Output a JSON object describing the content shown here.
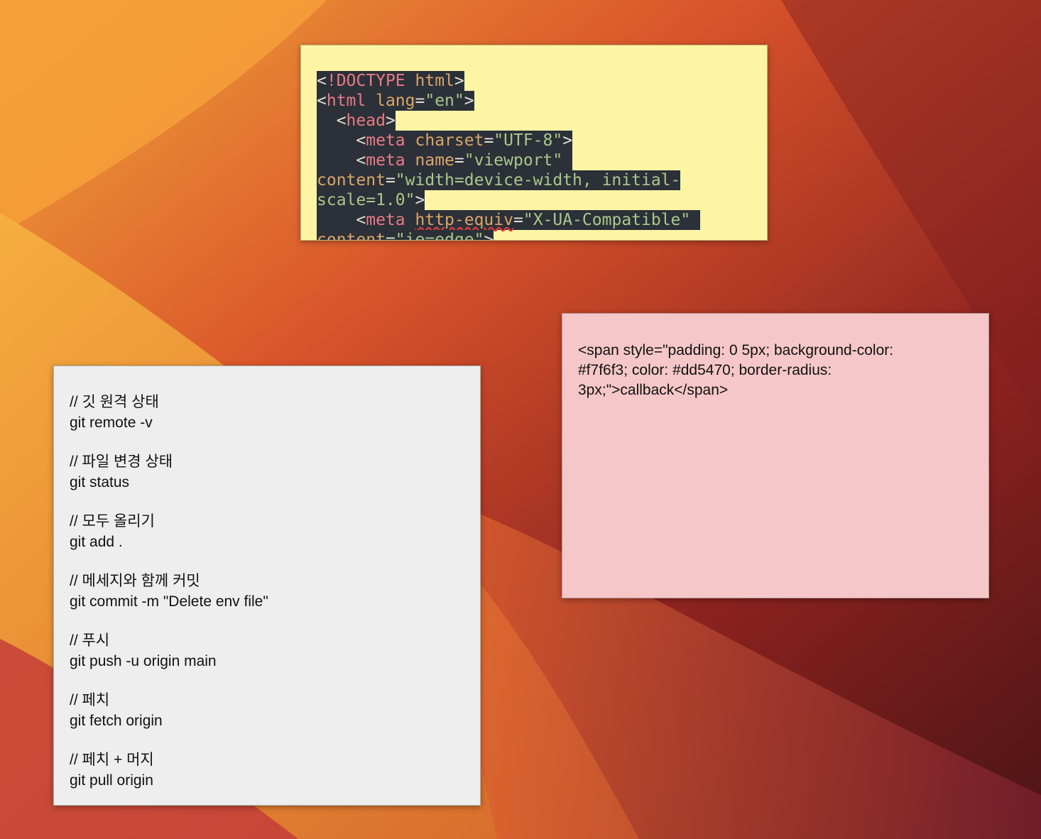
{
  "notes": {
    "yellow": {
      "color": "#fdf5a4",
      "code_lines": [
        [
          {
            "t": "<",
            "c": "punct"
          },
          {
            "t": "!DOCTYPE",
            "c": "bang"
          },
          {
            "t": " ",
            "c": "punct"
          },
          {
            "t": "html",
            "c": "attr"
          },
          {
            "t": ">",
            "c": "punct"
          }
        ],
        [
          {
            "t": "<",
            "c": "punct"
          },
          {
            "t": "html",
            "c": "tag"
          },
          {
            "t": " ",
            "c": "punct"
          },
          {
            "t": "lang",
            "c": "attr"
          },
          {
            "t": "=",
            "c": "punct"
          },
          {
            "t": "\"en\"",
            "c": "str"
          },
          {
            "t": ">",
            "c": "punct"
          }
        ],
        [
          {
            "t": "  <",
            "c": "punct"
          },
          {
            "t": "head",
            "c": "tag"
          },
          {
            "t": ">",
            "c": "punct"
          }
        ],
        [
          {
            "t": "    <",
            "c": "punct"
          },
          {
            "t": "meta",
            "c": "tag"
          },
          {
            "t": " ",
            "c": "punct"
          },
          {
            "t": "charset",
            "c": "attr"
          },
          {
            "t": "=",
            "c": "punct"
          },
          {
            "t": "\"UTF-8\"",
            "c": "str"
          },
          {
            "t": ">",
            "c": "punct"
          }
        ],
        [
          {
            "t": "    <",
            "c": "punct"
          },
          {
            "t": "meta",
            "c": "tag"
          },
          {
            "t": " ",
            "c": "punct"
          },
          {
            "t": "name",
            "c": "attr"
          },
          {
            "t": "=",
            "c": "punct"
          },
          {
            "t": "\"viewport\"",
            "c": "str"
          },
          {
            "t": " ",
            "c": "punct"
          }
        ],
        [
          {
            "t": "content",
            "c": "attr"
          },
          {
            "t": "=",
            "c": "punct"
          },
          {
            "t": "\"width=device-width, initial-",
            "c": "str"
          }
        ],
        [
          {
            "t": "scale=1.0\"",
            "c": "str"
          },
          {
            "t": ">",
            "c": "punct"
          }
        ],
        [
          {
            "t": "    <",
            "c": "punct"
          },
          {
            "t": "meta",
            "c": "tag"
          },
          {
            "t": " ",
            "c": "punct"
          },
          {
            "t": "http-equiv",
            "c": "attr err"
          },
          {
            "t": "=",
            "c": "punct"
          },
          {
            "t": "\"X-UA-Compatible\"",
            "c": "str"
          },
          {
            "t": " ",
            "c": "punct"
          }
        ],
        [
          {
            "t": "content",
            "c": "attr"
          },
          {
            "t": "=",
            "c": "punct"
          },
          {
            "t": "\"ie=edge\"",
            "c": "str"
          },
          {
            "t": ">",
            "c": "punct"
          }
        ]
      ]
    },
    "pink": {
      "color": "#f6c7c9",
      "lines": [
        "<span style=\"padding: 0 5px; background-color:",
        "#f7f6f3; color: #dd5470; border-radius:",
        "3px;\">callback</span>"
      ]
    },
    "gray": {
      "color": "#eeeeee",
      "blocks": [
        {
          "comment": "// 깃 원격 상태",
          "command": "git remote -v"
        },
        {
          "comment": "// 파일 변경 상태",
          "command": "git status"
        },
        {
          "comment": "// 모두 올리기",
          "command": "git add ."
        },
        {
          "comment": "// 메세지와 함께 커밋",
          "command": "git commit -m \"Delete env file\""
        },
        {
          "comment": "// 푸시",
          "command": "git push -u origin main"
        },
        {
          "comment": "// 페치",
          "command": "git fetch origin"
        },
        {
          "comment": "// 페치 + 머지",
          "command": "git pull origin"
        }
      ]
    }
  }
}
